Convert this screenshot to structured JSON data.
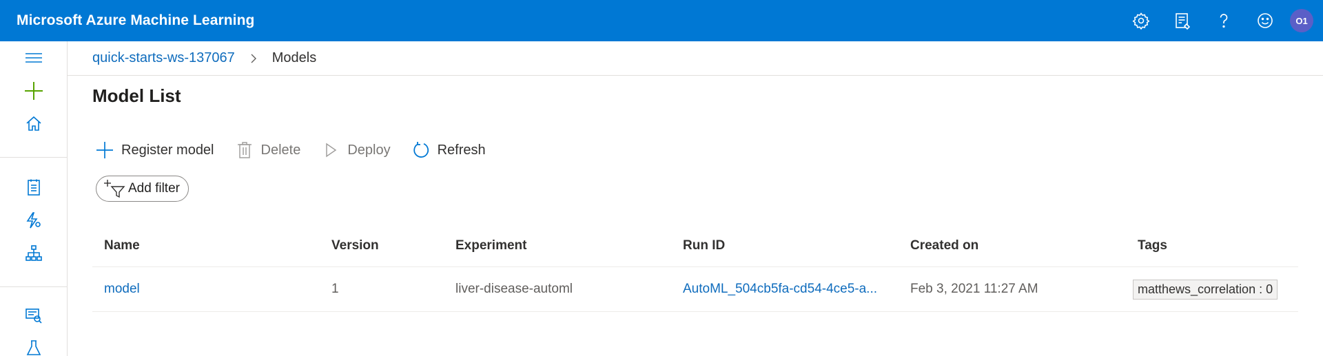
{
  "header": {
    "app_title": "Microsoft Azure Machine Learning",
    "avatar_initials": "O1",
    "icons": [
      "gear-icon",
      "feedback-list-icon",
      "help-icon",
      "smiley-icon"
    ],
    "bg_color": "#0078d4"
  },
  "nav": {
    "icons": [
      "hamburger-icon",
      "plus-icon",
      "home-icon",
      "notebook-icon",
      "automl-icon",
      "designer-icon",
      "datasets-icon",
      "experiments-icon"
    ]
  },
  "breadcrumb": {
    "workspace": "quick-starts-ws-137067",
    "current": "Models"
  },
  "page": {
    "title": "Model List"
  },
  "toolbar": {
    "register_label": "Register model",
    "delete_label": "Delete",
    "deploy_label": "Deploy",
    "refresh_label": "Refresh",
    "filter_label": "Add filter"
  },
  "table": {
    "headers": {
      "name": "Name",
      "version": "Version",
      "experiment": "Experiment",
      "run_id": "Run ID",
      "created_on": "Created on",
      "tags": "Tags"
    },
    "rows": [
      {
        "name": "model",
        "version": "1",
        "experiment": "liver-disease-automl",
        "run_id": "AutoML_504cb5fa-cd54-4ce5-a...",
        "created_on": "Feb 3, 2021 11:27 AM",
        "tag": "matthews_correlation : 0"
      }
    ]
  }
}
